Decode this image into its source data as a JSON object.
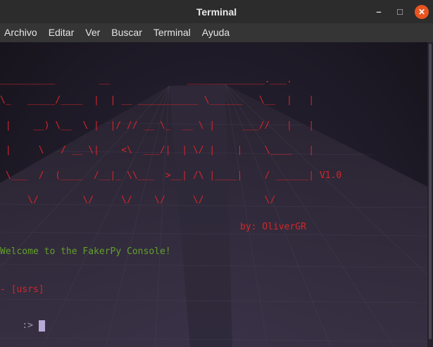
{
  "window": {
    "title": "Terminal",
    "buttons": {
      "minimize": "–",
      "maximize": "□",
      "close": "✕"
    }
  },
  "menu": [
    "Archivo",
    "Editar",
    "Ver",
    "Buscar",
    "Terminal",
    "Ayuda"
  ],
  "terminal": {
    "banner": [
      "__________        __              ______________.___.",
      "\\_   _____/____  |  | __ ___________ \\______   \\__  |   |",
      " |    __) \\__  \\ |  |/ // __ \\_  __ \\ |     ___//   |   |",
      " |     \\   / __ \\|    <\\  ___/|  | \\/ |    |    \\____   |",
      " \\___  /  (____  /__|_ \\\\___  >__| /\\ |____|    / ______| V1.0",
      "     \\/        \\/     \\/    \\/     \\/           \\/"
    ],
    "author": "by: OliverGR",
    "welcome": "Welcome to the FakerPy Console!",
    "context": "- [usrs]",
    "prompt": ":>"
  },
  "colors": {
    "banner": "#d3262a",
    "welcome": "#63a02a",
    "prompt": "#9b97a2",
    "cursor": "#b7a9d6"
  }
}
